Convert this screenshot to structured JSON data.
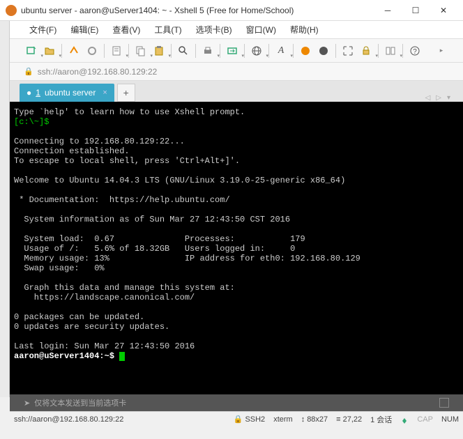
{
  "window": {
    "title": "ubuntu server - aaron@uServer1404: ~ - Xshell 5 (Free for Home/School)"
  },
  "menu": {
    "file": "文件(F)",
    "edit": "编辑(E)",
    "view": "查看(V)",
    "tools": "工具(T)",
    "tabs": "选项卡(B)",
    "window": "窗口(W)",
    "help": "帮助(H)"
  },
  "address": {
    "url": "ssh://aaron@192.168.80.129:22"
  },
  "tabs": {
    "active_num": "1",
    "active_label": "ubuntu server"
  },
  "terminal": {
    "line1": "Type `help' to learn how to use Xshell prompt.",
    "prompt1": "[c:\\~]$",
    "conn1": "Connecting to 192.168.80.129:22...",
    "conn2": "Connection established.",
    "conn3": "To escape to local shell, press 'Ctrl+Alt+]'.",
    "welcome": "Welcome to Ubuntu 14.04.3 LTS (GNU/Linux 3.19.0-25-generic x86_64)",
    "doc": " * Documentation:  https://help.ubuntu.com/",
    "sysinfo": "  System information as of Sun Mar 27 12:43:50 CST 2016",
    "row1": "  System load:  0.67              Processes:           179",
    "row2": "  Usage of /:   5.6% of 18.32GB   Users logged in:     0",
    "row3": "  Memory usage: 13%               IP address for eth0: 192.168.80.129",
    "row4": "  Swap usage:   0%",
    "graph1": "  Graph this data and manage this system at:",
    "graph2": "    https://landscape.canonical.com/",
    "upd1": "0 packages can be updated.",
    "upd2": "0 updates are security updates.",
    "last": "Last login: Sun Mar 27 12:43:50 2016",
    "prompt2": "aaron@uServer1404:~$ "
  },
  "prompt_hint": "仅将文本发送到当前选项卡",
  "status": {
    "conn": "ssh://aaron@192.168.80.129:22",
    "proto": "SSH2",
    "term": "xterm",
    "size": "88x27",
    "pos": "27,22",
    "sess": "1 会话",
    "cap": "CAP",
    "num": "NUM"
  }
}
